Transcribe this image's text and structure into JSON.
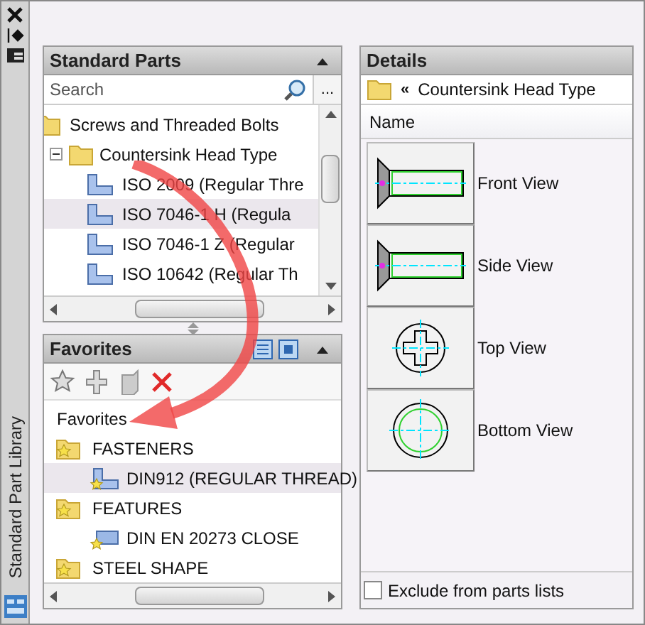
{
  "sidebar": {
    "title": "Standard Part Library"
  },
  "standard_parts": {
    "title": "Standard Parts",
    "search": {
      "placeholder": "Search"
    },
    "more_button": "...",
    "tree": [
      {
        "label": "Screws and Threaded Bolts",
        "kind": "folder",
        "selected": false,
        "children": [
          {
            "label": "Countersink Head Type",
            "kind": "folder",
            "expanded": true,
            "selected": false,
            "children": [
              {
                "label": "ISO 2009  (Regular Thre",
                "kind": "part",
                "selected": false
              },
              {
                "label": "ISO 7046-1  H  (Regula",
                "kind": "part",
                "selected": true
              },
              {
                "label": "ISO 7046-1  Z  (Regular",
                "kind": "part",
                "selected": false
              },
              {
                "label": "ISO 10642  (Regular Th",
                "kind": "part",
                "selected": false
              }
            ]
          }
        ]
      }
    ]
  },
  "favorites": {
    "title": "Favorites",
    "root": "Favorites",
    "tree": [
      {
        "label": "FASTENERS",
        "kind": "folder",
        "selected": false,
        "children": [
          {
            "label": "DIN912 (REGULAR THREAD)",
            "kind": "part",
            "selected": true
          }
        ]
      },
      {
        "label": "FEATURES",
        "kind": "folder",
        "selected": false,
        "children": [
          {
            "label": "DIN EN 20273 CLOSE",
            "kind": "feature",
            "selected": false
          }
        ]
      },
      {
        "label": "STEEL SHAPE",
        "kind": "folder",
        "selected": false
      }
    ]
  },
  "details": {
    "title": "Details",
    "path_prefix": "«",
    "path": "Countersink Head Type",
    "column": "Name",
    "views": [
      {
        "label": "Front View",
        "kind": "front"
      },
      {
        "label": "Side View",
        "kind": "side"
      },
      {
        "label": "Top View",
        "kind": "top"
      },
      {
        "label": "Bottom View",
        "kind": "bottom"
      }
    ],
    "exclude": {
      "label": "Exclude from parts lists",
      "checked": false
    }
  }
}
